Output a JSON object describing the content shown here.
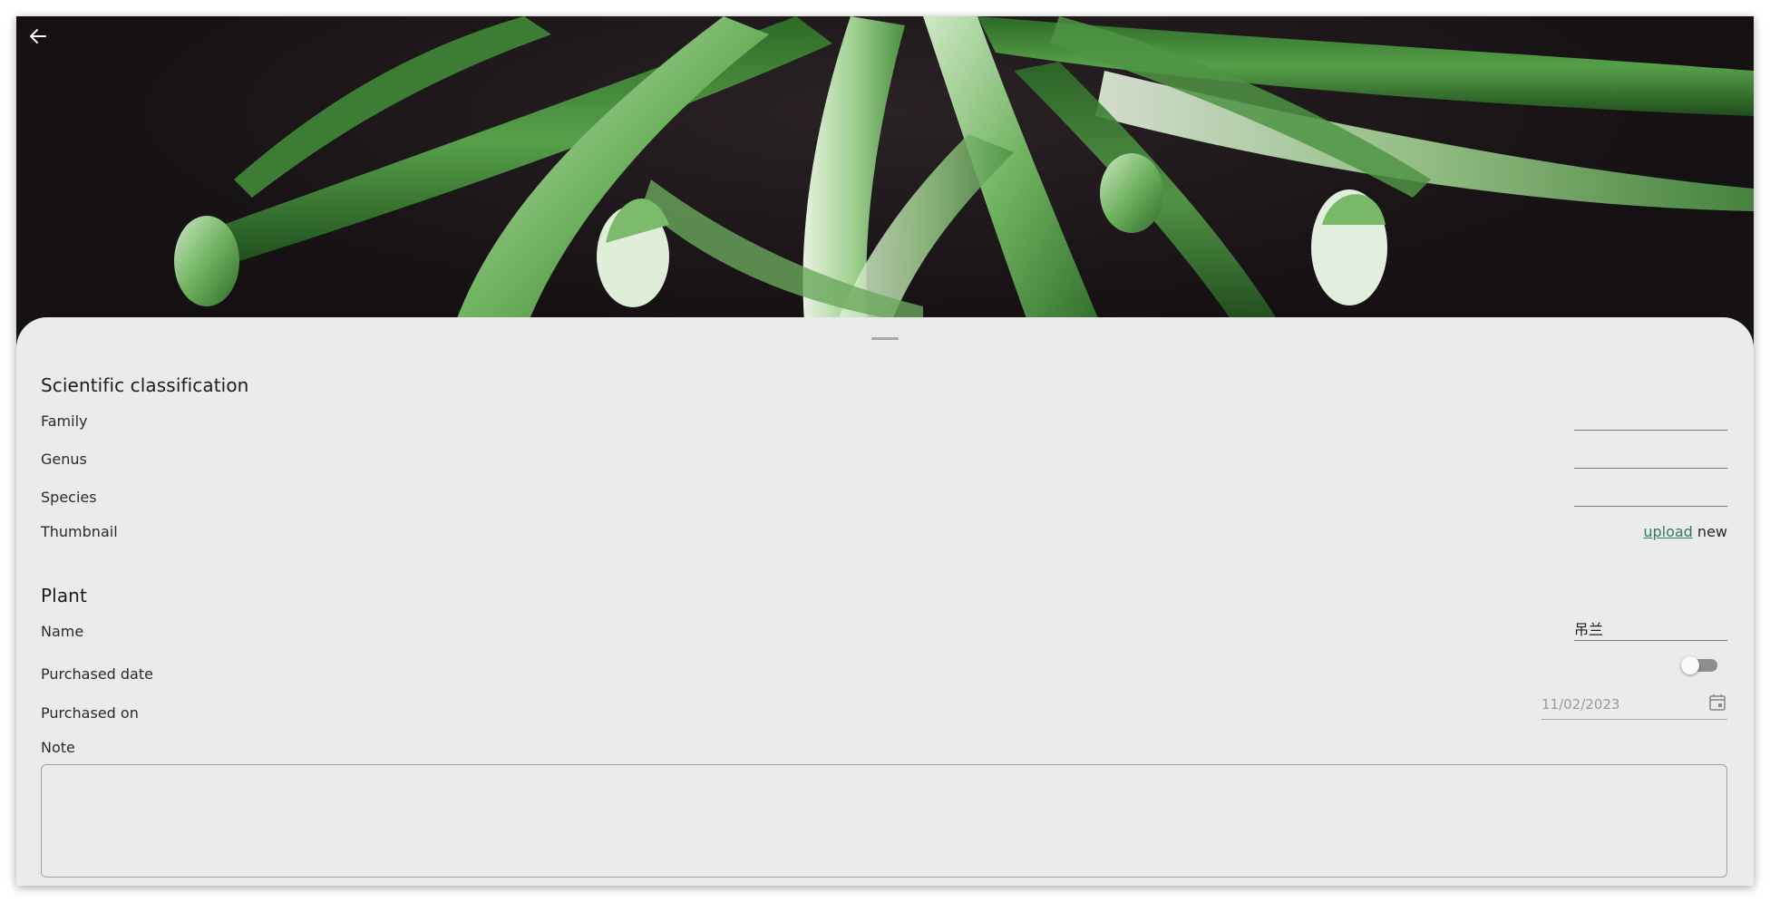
{
  "header": {
    "back_icon": "arrow-left-icon"
  },
  "classification": {
    "title": "Scientific classification",
    "family_label": "Family",
    "family_value": "",
    "genus_label": "Genus",
    "genus_value": "",
    "species_label": "Species",
    "species_value": "",
    "thumbnail_label": "Thumbnail",
    "upload_link": "upload",
    "upload_suffix": "new"
  },
  "plant": {
    "title": "Plant",
    "name_label": "Name",
    "name_value": "吊兰",
    "purchased_date_label": "Purchased date",
    "purchased_date_toggle": "off",
    "purchased_on_label": "Purchased on",
    "purchased_on_value": "11/02/2023",
    "calendar_icon": "calendar-icon",
    "note_label": "Note",
    "note_value": ""
  },
  "colors": {
    "accent": "#2e7d5b",
    "sheet_bg": "#ebebeb"
  }
}
